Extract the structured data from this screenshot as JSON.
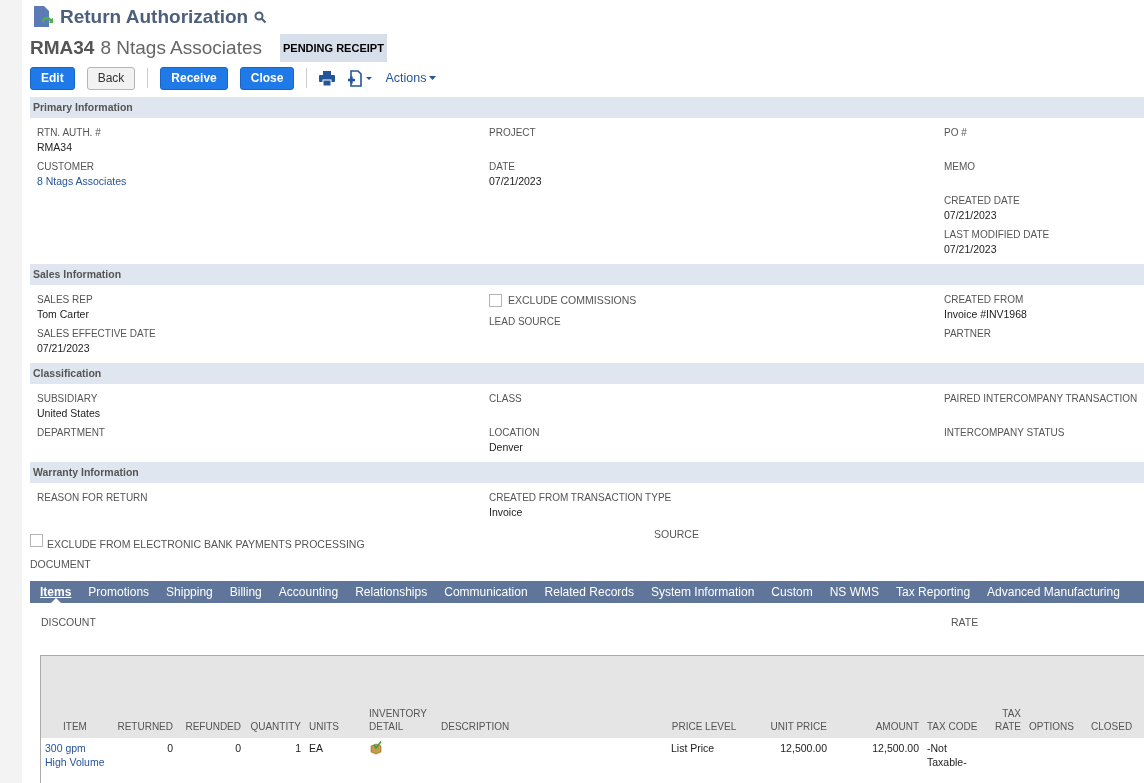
{
  "header": {
    "title": "Return Authorization",
    "record_number": "RMA34",
    "record_name": "8 Ntags Associates",
    "status": "PENDING RECEIPT"
  },
  "toolbar": {
    "buttons": [
      {
        "label": "Edit",
        "kind": "primary"
      },
      {
        "label": "Back",
        "kind": "secondary"
      },
      {
        "label": "Receive",
        "kind": "primary"
      },
      {
        "label": "Close",
        "kind": "primary"
      }
    ],
    "actions_label": "Actions"
  },
  "sections": [
    {
      "title": "Primary Information",
      "columns": [
        [
          {
            "label": "RTN. AUTH. #",
            "value": "RMA34",
            "kind": "text"
          },
          {
            "label": "CUSTOMER",
            "value": "8 Ntags Associates",
            "kind": "link"
          }
        ],
        [
          {
            "label": "PROJECT",
            "kind": "text"
          },
          {
            "label": "DATE",
            "value": "07/21/2023",
            "kind": "text"
          }
        ],
        [
          {
            "label": "PO #",
            "kind": "text"
          },
          {
            "label": "MEMO",
            "kind": "text"
          },
          {
            "label": "CREATED DATE",
            "value": "07/21/2023",
            "kind": "text"
          },
          {
            "label": "LAST MODIFIED DATE",
            "value": "07/21/2023",
            "kind": "text"
          }
        ]
      ]
    },
    {
      "title": "Sales Information",
      "columns": [
        [
          {
            "label": "SALES REP",
            "value": "Tom Carter",
            "kind": "text"
          },
          {
            "label": "SALES EFFECTIVE DATE",
            "value": "07/21/2023",
            "kind": "text"
          }
        ],
        [
          {
            "label": "EXCLUDE COMMISSIONS",
            "kind": "checkbox",
            "checked": false
          },
          {
            "label": "LEAD SOURCE",
            "kind": "text"
          }
        ],
        [
          {
            "label": "CREATED FROM",
            "value": "Invoice #INV1968",
            "kind": "text"
          },
          {
            "label": "PARTNER",
            "kind": "text"
          }
        ]
      ]
    },
    {
      "title": "Classification",
      "columns": [
        [
          {
            "label": "SUBSIDIARY",
            "value": "United States",
            "kind": "text"
          },
          {
            "label": "DEPARTMENT",
            "kind": "text"
          }
        ],
        [
          {
            "label": "CLASS",
            "kind": "text"
          },
          {
            "label": "LOCATION",
            "value": "Denver",
            "kind": "text"
          }
        ],
        [
          {
            "label": "PAIRED INTERCOMPANY TRANSACTION",
            "kind": "text"
          },
          {
            "label": "INTERCOMPANY STATUS",
            "kind": "text"
          }
        ]
      ]
    },
    {
      "title": "Warranty Information",
      "columns": [
        [
          {
            "label": "REASON FOR RETURN",
            "kind": "text"
          }
        ],
        [
          {
            "label": "CREATED FROM TRANSACTION TYPE",
            "value": "Invoice",
            "kind": "text"
          }
        ],
        []
      ],
      "extra": {
        "checkbox": {
          "label": "EXCLUDE FROM ELECTRONIC BANK PAYMENTS PROCESSING",
          "checked": false
        },
        "source_label": "SOURCE",
        "document_label": "DOCUMENT"
      }
    }
  ],
  "tabs": [
    {
      "label": "Items",
      "selected": true
    },
    {
      "label": "Promotions",
      "selected": false
    },
    {
      "label": "Shipping",
      "selected": false
    },
    {
      "label": "Billing",
      "selected": false
    },
    {
      "label": "Accounting",
      "selected": false
    },
    {
      "label": "Relationships",
      "selected": false
    },
    {
      "label": "Communication",
      "selected": false
    },
    {
      "label": "Related Records",
      "selected": false
    },
    {
      "label": "System Information",
      "selected": false
    },
    {
      "label": "Custom",
      "selected": false
    },
    {
      "label": "NS WMS",
      "selected": false
    },
    {
      "label": "Tax Reporting",
      "selected": false
    },
    {
      "label": "Advanced Manufacturing",
      "selected": false
    }
  ],
  "items_fields": {
    "discount_label": "DISCOUNT",
    "rate_label": "RATE"
  },
  "table": {
    "columns": [
      "ITEM",
      "RETURNED",
      "REFUNDED",
      "QUANTITY",
      "UNITS",
      "INVENTORY DETAIL",
      "DESCRIPTION",
      "PRICE LEVEL",
      "UNIT PRICE",
      "AMOUNT",
      "TAX CODE",
      "TAX RATE",
      "OPTIONS",
      "CLOSED"
    ],
    "rows": [
      {
        "item": "300 gpm High Volume",
        "returned": "0",
        "refunded": "0",
        "quantity": "1",
        "units": "EA",
        "price_level": "List Price",
        "unit_price": "12,500.00",
        "amount": "12,500.00",
        "tax_code": "-Not Taxable-"
      }
    ]
  }
}
